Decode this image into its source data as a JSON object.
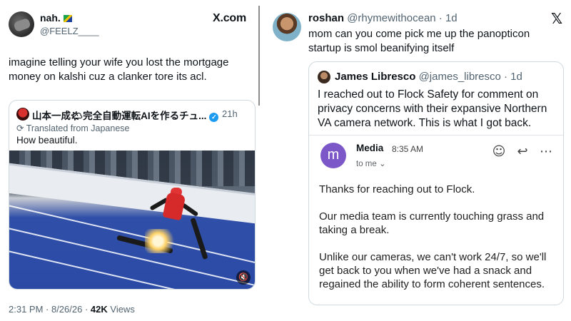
{
  "left_post": {
    "display_name": "nah.",
    "handle": "@FEELZ____",
    "site_label": "X.com",
    "text": "imagine telling your wife you lost the mortgage money on kalshi cuz a clanker tore its acl.",
    "quote": {
      "author": "山本一成🌤完全自動運転AIを作るチュ...",
      "time": "21h",
      "translated_label": "Translated from Japanese",
      "text": "How beautiful.",
      "mute_icon": "🔇"
    },
    "timestamp": "2:31 PM · 8/26/26 · ",
    "views_count": "42K",
    "views_label": " Views"
  },
  "right_post": {
    "display_name": "roshan",
    "handle": "@rhymewithocean · 1d",
    "text": "mom can you come pick me up the panopticon startup is smol beanifying itself",
    "x_logo": "𝕏",
    "quote": {
      "author": "James Libresco",
      "handle": "@james_libresco · 1d",
      "text": "I reached out to Flock Safety for comment on privacy concerns with their expansive Northern VA camera network. This is what I got back.",
      "email": {
        "avatar_letter": "m",
        "sender": "Media",
        "time": "8:35 AM",
        "to_label": "to me ⌄",
        "icons": {
          "emoji": "☺",
          "reply": "↩",
          "more": "⋯"
        },
        "body": [
          "Thanks for reaching out to Flock.",
          "Our media team is currently touching grass and taking a break.",
          "Unlike our cameras, we can't work 24/7, so we'll get back to you when we've had a snack and regained the ability to form coherent sentences."
        ]
      }
    }
  },
  "colors": {
    "verified": "#1d9bf0",
    "email_avatar": "#7b57c7",
    "secondary_text": "#536471"
  }
}
